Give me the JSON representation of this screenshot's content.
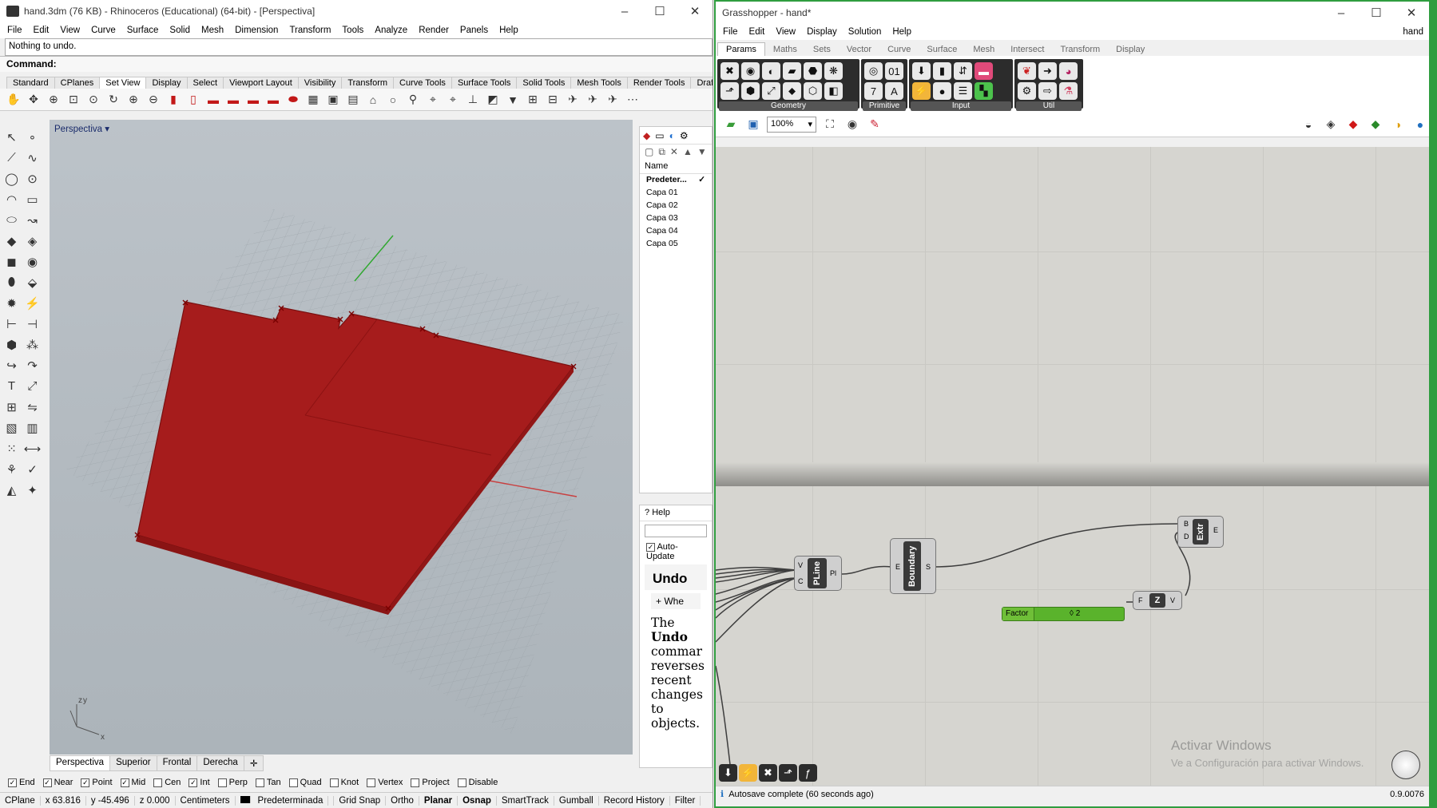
{
  "rhino": {
    "title": "hand.3dm (76 KB) - Rhinoceros (Educational) (64-bit) - [Perspectiva]",
    "menu": [
      "File",
      "Edit",
      "View",
      "Curve",
      "Surface",
      "Solid",
      "Mesh",
      "Dimension",
      "Transform",
      "Tools",
      "Analyze",
      "Render",
      "Panels",
      "Help"
    ],
    "history_text": "Nothing to undo.",
    "command_label": "Command:",
    "toolbar_tabs": [
      "Standard",
      "CPlanes",
      "Set View",
      "Display",
      "Select",
      "Viewport Layout",
      "Visibility",
      "Transform",
      "Curve Tools",
      "Surface Tools",
      "Solid Tools",
      "Mesh Tools",
      "Render Tools",
      "Draf"
    ],
    "active_toolbar_tab": "Set View",
    "viewport_title": "Perspectiva",
    "viewport_tabs": [
      "Perspectiva",
      "Superior",
      "Frontal",
      "Derecha"
    ],
    "axis_labels": {
      "y": "y",
      "z": "z",
      "x": "x"
    },
    "layers": {
      "header": "Name",
      "items": [
        {
          "name": "Predeter...",
          "check": "✓"
        },
        {
          "name": "Capa 01",
          "check": ""
        },
        {
          "name": "Capa 02",
          "check": ""
        },
        {
          "name": "Capa 03",
          "check": ""
        },
        {
          "name": "Capa 04",
          "check": ""
        },
        {
          "name": "Capa 05",
          "check": ""
        }
      ]
    },
    "help": {
      "tab": "Help",
      "auto_update": "Auto-Update",
      "title": "Undo",
      "button": "+ Whe",
      "body_pre": "The",
      "body_bold": "Undo",
      "body_rest": "commar reverses recent changes to objects."
    },
    "osnaps": [
      {
        "label": "End",
        "checked": true
      },
      {
        "label": "Near",
        "checked": true
      },
      {
        "label": "Point",
        "checked": true
      },
      {
        "label": "Mid",
        "checked": true
      },
      {
        "label": "Cen",
        "checked": false
      },
      {
        "label": "Int",
        "checked": true
      },
      {
        "label": "Perp",
        "checked": false
      },
      {
        "label": "Tan",
        "checked": false
      },
      {
        "label": "Quad",
        "checked": false
      },
      {
        "label": "Knot",
        "checked": false
      },
      {
        "label": "Vertex",
        "checked": false
      },
      {
        "label": "Project",
        "checked": false
      },
      {
        "label": "Disable",
        "checked": false
      }
    ],
    "status": {
      "cplane": "CPlane",
      "x": "x 63.816",
      "y": "y -45.496",
      "z": "z 0.000",
      "units": "Centimeters",
      "layer": "Predeterminada",
      "grid_snap": "Grid Snap",
      "ortho": "Ortho",
      "planar": "Planar",
      "osnap": "Osnap",
      "smarttrack": "SmartTrack",
      "gumball": "Gumball",
      "record_history": "Record History",
      "filter": "Filter"
    },
    "shape_color": "#a61c1c"
  },
  "gh": {
    "title": "Grasshopper - hand*",
    "menu": [
      "File",
      "Edit",
      "View",
      "Display",
      "Solution",
      "Help"
    ],
    "doc_name": "hand",
    "tabs": [
      "Params",
      "Maths",
      "Sets",
      "Vector",
      "Curve",
      "Surface",
      "Mesh",
      "Intersect",
      "Transform",
      "Display"
    ],
    "active_tab": "Params",
    "groups": [
      "Geometry",
      "Primitive",
      "Input",
      "Util"
    ],
    "zoom": "100%",
    "nodes": {
      "pline": {
        "label": "PLine",
        "in": [
          "V",
          "C"
        ],
        "out": "Pl"
      },
      "boundary": {
        "label": "Boundary",
        "in": "E",
        "out": "S"
      },
      "extr": {
        "label": "Extr",
        "in": [
          "B",
          "D"
        ],
        "out": "E"
      },
      "unit": {
        "label": "Z",
        "in": "F",
        "out": "V"
      }
    },
    "slider": {
      "name": "Factor",
      "value": "◊ 2"
    },
    "watermark_title": "Activar Windows",
    "watermark_sub": "Ve a Configuración para activar Windows.",
    "status": "Autosave complete (60 seconds ago)",
    "version": "0.9.0076",
    "accent": "#2f9d3f"
  }
}
